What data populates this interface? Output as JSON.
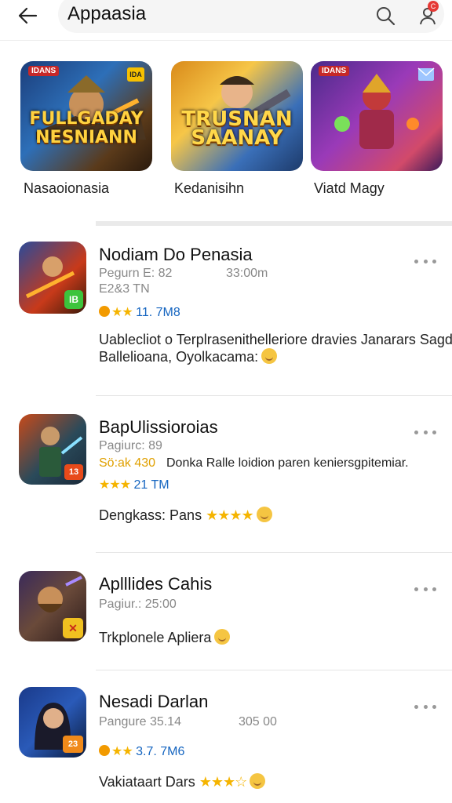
{
  "header": {
    "title": "Appaasia",
    "badge": "C"
  },
  "featured": [
    {
      "name": "Nasaoionasia",
      "tag": "IDANS",
      "tag2": "IDA",
      "logo": "FULLGADAY NESNIANN"
    },
    {
      "name": "Kedanisihn",
      "tag": "",
      "tag2": "",
      "logo": "TRUSNAN SAANAY"
    },
    {
      "name": "Viatd Magy",
      "tag": "IDANS",
      "tag2": "",
      "logo": ""
    }
  ],
  "items": [
    {
      "title": "Nodiam Do Penasia",
      "meta1": "Pegurn E: 82",
      "meta1b": "33:00m",
      "meta2": "E2&3 TN",
      "rating": "11. 7M8",
      "desc1": "Uablecliot o Terplrasenithelleriore dravies Janarars Sagdn",
      "desc2": "Ballelioana, Oyolkacama:",
      "icon_badge": "IB"
    },
    {
      "title": "BapUlissioroias",
      "meta1": "Pagiurc: 89",
      "meta2": "Sö:ak 430",
      "meta2b": "Donka Ralle loidion paren keniersgpitemiar.",
      "rating": "21 TM",
      "desc1": "Dengkass: Pans",
      "icon_badge": "13"
    },
    {
      "title": "Aplllides Cahis",
      "meta1": "Pagiur.: 25:00",
      "desc1": "Trkplonele Apliera",
      "icon_badge": "✕"
    },
    {
      "title": "Nesadi Darlan",
      "meta1": "Pangure 35.14",
      "meta1b": "305 00",
      "rating": "3.7. 7M6",
      "desc1": "Vakiataart Dars",
      "icon_badge": "23"
    }
  ],
  "colors": {
    "accent_blue": "#1565c0",
    "star": "#f5b400",
    "badge_red": "#e53935"
  }
}
